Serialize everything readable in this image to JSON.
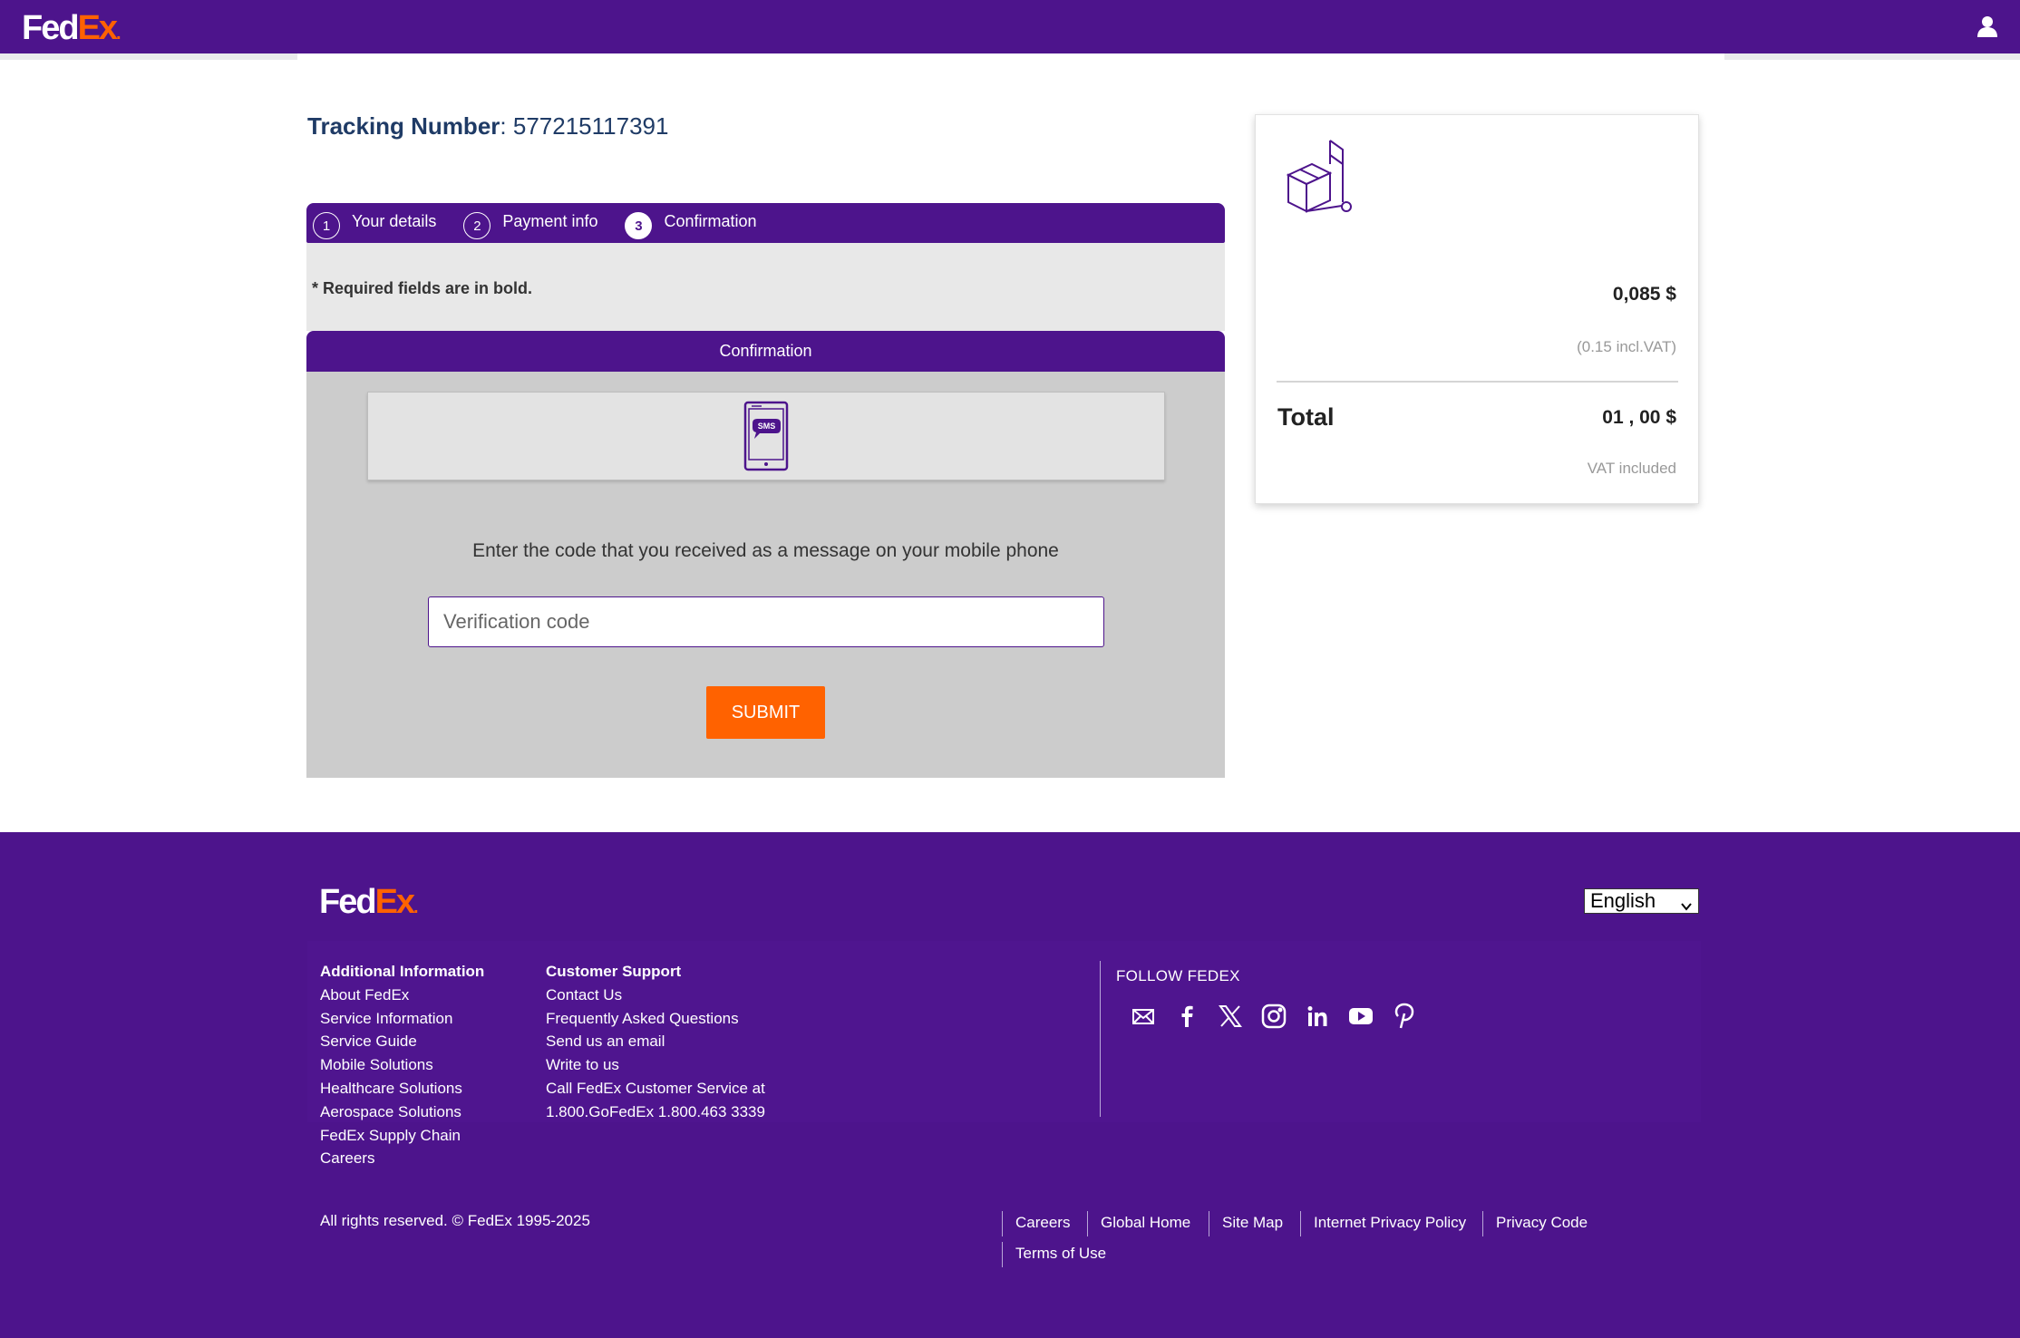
{
  "header": {
    "logo_fed": "Fed",
    "logo_ex": "Ex",
    "logo_dot": ".",
    "user_icon": "user-icon"
  },
  "tracking": {
    "label": "Tracking Number",
    "separator": ": ",
    "number": "577215117391"
  },
  "steps": [
    {
      "num": "1",
      "label": "Your details",
      "active": false
    },
    {
      "num": "2",
      "label": "Payment info",
      "active": false
    },
    {
      "num": "3",
      "label": "Confirmation",
      "active": true
    }
  ],
  "required_note": "* Required fields are in bold.",
  "confirmation": {
    "title": "Confirmation",
    "sms_badge": "SMS",
    "icon": "sms-phone-icon",
    "prompt": "Enter the code that you received as a message on your mobile phone",
    "input_placeholder": "Verification code",
    "input_value": "",
    "submit_label": "SUBMIT"
  },
  "summary": {
    "icon": "package-box-icon",
    "price": "0,085 $",
    "vat_note": "(0.15 incl.VAT)",
    "total_label": "Total",
    "total_value": "01 , 00 $",
    "vat_included": "VAT included"
  },
  "footer": {
    "logo_fed": "Fed",
    "logo_ex": "Ex",
    "logo_dot": ".",
    "language": "English",
    "additional": {
      "title": "Additional Information",
      "links": [
        "About FedEx",
        "Service Information",
        "Service Guide",
        "Mobile Solutions",
        "Healthcare Solutions",
        "Aerospace Solutions",
        "FedEx Supply Chain",
        "Careers"
      ]
    },
    "support": {
      "title": "Customer Support",
      "links": [
        "Contact Us",
        "Frequently Asked Questions",
        "Send us an email",
        "Write to us",
        "Call FedEx Customer Service at",
        "1.800.GoFedEx 1.800.463 3339"
      ]
    },
    "follow_title": "FOLLOW FEDEX",
    "social": [
      "email-icon",
      "facebook-icon",
      "x-twitter-icon",
      "instagram-icon",
      "linkedin-icon",
      "youtube-icon",
      "pinterest-icon"
    ],
    "copyright": "All rights reserved. © FedEx 1995-2025",
    "legal_links": [
      "Careers",
      "Global Home",
      "Site Map",
      "Internet Privacy Policy",
      "Privacy Code",
      "Terms of Use"
    ]
  },
  "colors": {
    "brand_purple": "#4d148c",
    "brand_orange": "#ff6200"
  }
}
